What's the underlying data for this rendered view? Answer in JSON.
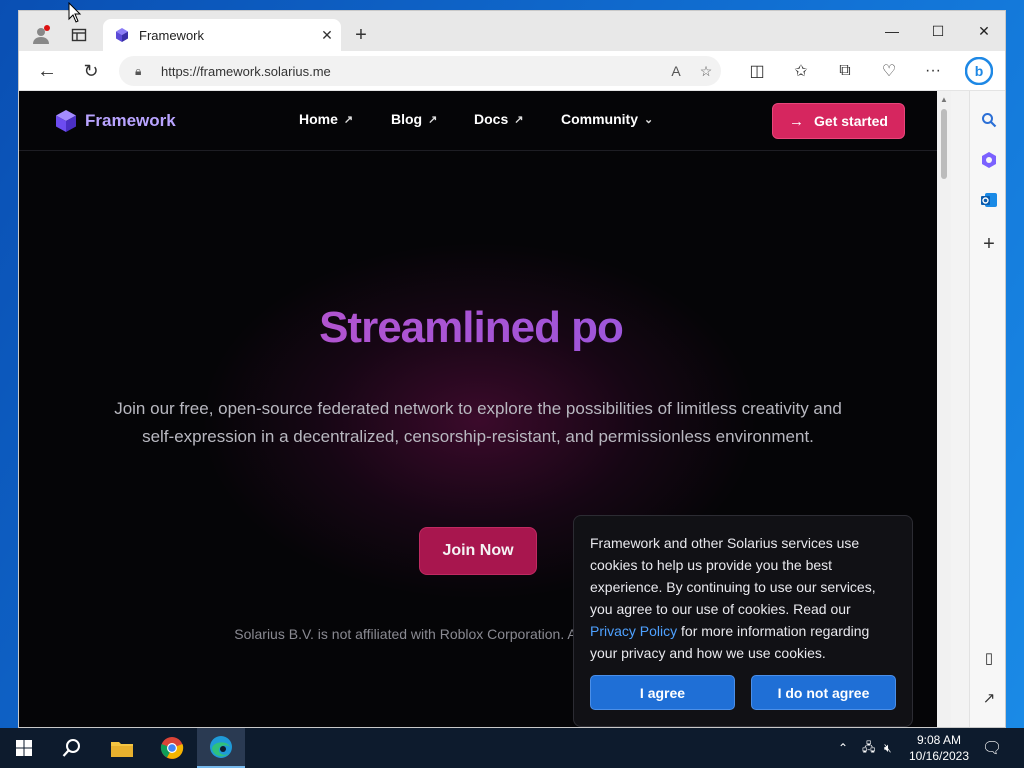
{
  "browser": {
    "tab": {
      "title": "Framework"
    },
    "address": {
      "url": "https://framework.solarius.me"
    }
  },
  "page": {
    "logo_text": "Framework",
    "nav": [
      {
        "label": "Home"
      },
      {
        "label": "Blog"
      },
      {
        "label": "Docs"
      },
      {
        "label": "Community"
      }
    ],
    "cta_label": "Get started",
    "hero_title": "Streamlined po",
    "hero_text": "Join our free, open-source federated network to explore the possibilities of limitless creativity and self-expression in a decentralized, censorship-resistant, and permissionless environment.",
    "join_label": "Join Now",
    "disclaimer": "Solarius B.V. is not affiliated with Roblox Corporation. All tra respective owners."
  },
  "cookie": {
    "text_before": "Framework and other Solarius services use cookies to help us provide you the best experience. By continuing to use our services, you agree to our use of cookies. Read our ",
    "link": "Privacy Policy",
    "text_after": " for more information regarding your privacy and how we use cookies.",
    "agree": "I agree",
    "disagree": "I do not agree"
  },
  "taskbar": {
    "time": "9:08 AM",
    "date": "10/16/2023"
  },
  "colors": {
    "accent": "#d6265f",
    "join": "#a8164e",
    "cookie_button": "#1f6fd6",
    "link": "#4ea1ff"
  }
}
